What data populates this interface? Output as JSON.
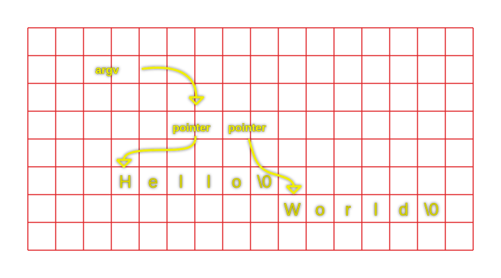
{
  "colors": {
    "grid": "#e0262a",
    "annotation": "#f0ee00",
    "text": "#d8d400",
    "background": "#ffffff"
  },
  "labels": {
    "argv": "argv",
    "pointer1": "pointer",
    "pointer2": "pointer"
  },
  "strings": {
    "first": [
      "H",
      "e",
      "l",
      "l",
      "o",
      "\\0"
    ],
    "second": [
      "W",
      "o",
      "r",
      "l",
      "d",
      "\\0"
    ]
  }
}
